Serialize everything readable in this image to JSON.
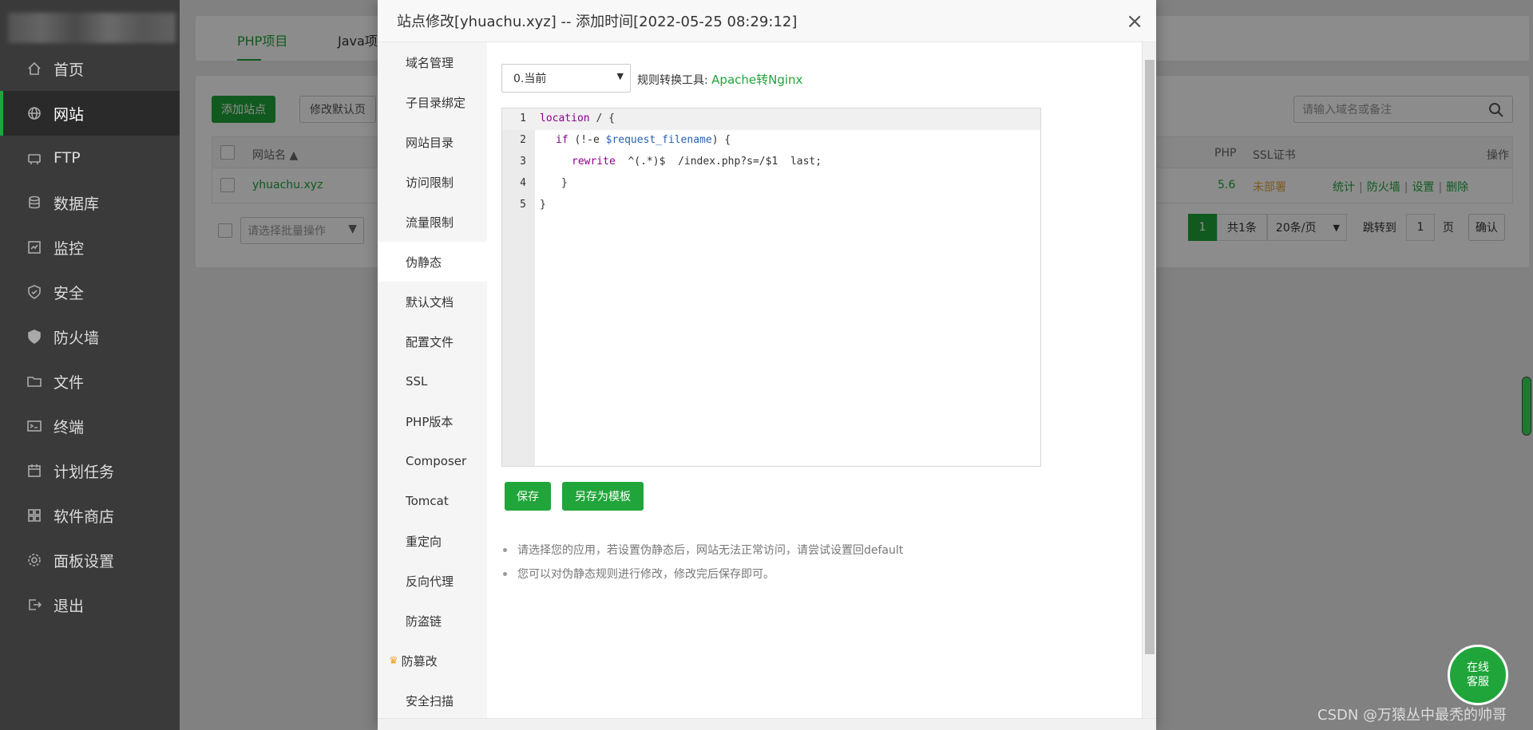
{
  "sidebar": {
    "items": [
      {
        "label": "首页",
        "icon": "home-icon"
      },
      {
        "label": "网站",
        "icon": "globe-icon"
      },
      {
        "label": "FTP",
        "icon": "ftp-icon"
      },
      {
        "label": "数据库",
        "icon": "database-icon"
      },
      {
        "label": "监控",
        "icon": "monitor-icon"
      },
      {
        "label": "安全",
        "icon": "shield-icon"
      },
      {
        "label": "防火墙",
        "icon": "firewall-icon"
      },
      {
        "label": "文件",
        "icon": "folder-icon"
      },
      {
        "label": "终端",
        "icon": "terminal-icon"
      },
      {
        "label": "计划任务",
        "icon": "calendar-icon"
      },
      {
        "label": "软件商店",
        "icon": "grid-icon"
      },
      {
        "label": "面板设置",
        "icon": "gear-icon"
      },
      {
        "label": "退出",
        "icon": "logout-icon"
      }
    ],
    "active_index": 1
  },
  "project_tabs": [
    "PHP项目",
    "Java项目"
  ],
  "toolbar": {
    "add_site": "添加站点",
    "edit_default": "修改默认页"
  },
  "search": {
    "placeholder": "请输入域名或备注"
  },
  "table": {
    "headers": {
      "site": "网站名 ▲",
      "php": "PHP",
      "ssl": "SSL证书",
      "ops": "操作"
    },
    "row": {
      "site": "yhuachu.xyz",
      "php": "5.6",
      "ssl": "未部署"
    },
    "ops": [
      "统计",
      "防火墙",
      "设置",
      "删除"
    ]
  },
  "batch": {
    "placeholder": "请选择批量操作"
  },
  "pager": {
    "page": "1",
    "total": "共1条",
    "per_page": "20条/页",
    "goto": "跳转到",
    "goto_page": "1",
    "page_unit": "页",
    "confirm": "确认"
  },
  "modal": {
    "title": "站点修改[yhuachu.xyz] -- 添加时间[2022-05-25 08:29:12]",
    "close": "×",
    "nav": [
      "域名管理",
      "子目录绑定",
      "网站目录",
      "访问限制",
      "流量限制",
      "伪静态",
      "默认文档",
      "配置文件",
      "SSL",
      "PHP版本",
      "Composer",
      "Tomcat",
      "重定向",
      "反向代理",
      "防盗链",
      "防篡改",
      "安全扫描"
    ],
    "active_nav_index": 5,
    "template_select": "0.当前",
    "tool_label": "规则转换工具:",
    "tool_link": "Apache转Nginx",
    "code_lines": [
      {
        "n": "1",
        "text": "location / {"
      },
      {
        "n": "2",
        "text": "if (!-e $request_filename) {"
      },
      {
        "n": "3",
        "text": "rewrite  ^(.*)$  /index.php?s=/$1  last;"
      },
      {
        "n": "4",
        "text": "}"
      },
      {
        "n": "5",
        "text": "}"
      }
    ],
    "save": "保存",
    "save_template": "另存为模板",
    "tips": [
      "请选择您的应用，若设置伪静态后，网站无法正常访问，请尝试设置回default",
      "您可以对伪静态规则进行修改，修改完后保存即可。"
    ]
  },
  "chat": {
    "line1": "在线",
    "line2": "客服"
  },
  "watermark": "CSDN @万猿丛中最秃的帅哥",
  "colors": {
    "accent": "#20a53a",
    "sidebar": "#3a3a3a",
    "warning": "#e6a23c"
  }
}
